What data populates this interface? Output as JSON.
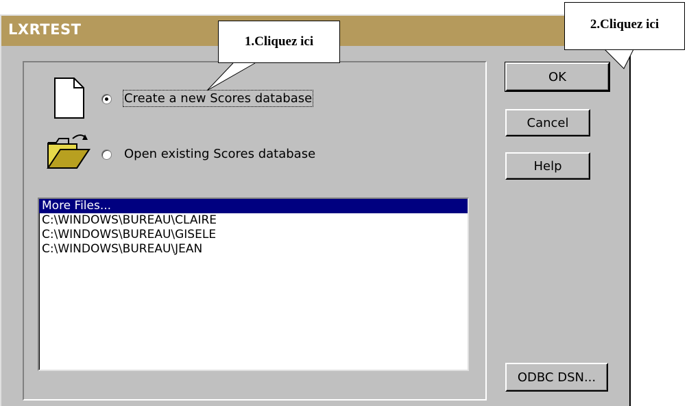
{
  "window": {
    "title": "LXRTEST"
  },
  "options": [
    {
      "label": "Create a new Scores database",
      "selected": true,
      "icon": "new-document-icon"
    },
    {
      "label": "Open existing Scores database",
      "selected": false,
      "icon": "open-folder-icon"
    }
  ],
  "buttons": {
    "ok": "OK",
    "cancel": "Cancel",
    "help": "Help",
    "odbc": "ODBC DSN..."
  },
  "recent_files": {
    "items": [
      "More Files...",
      "C:\\WINDOWS\\BUREAU\\CLAIRE",
      "C:\\WINDOWS\\BUREAU\\GISELE",
      "C:\\WINDOWS\\BUREAU\\JEAN"
    ],
    "selected_index": 0
  },
  "callouts": {
    "step1": "1.Cliquez ici",
    "step2": "2.Cliquez ici"
  },
  "colors": {
    "titlebar": "#b59a5c",
    "face": "#c0c0c0",
    "selection": "#000080"
  }
}
